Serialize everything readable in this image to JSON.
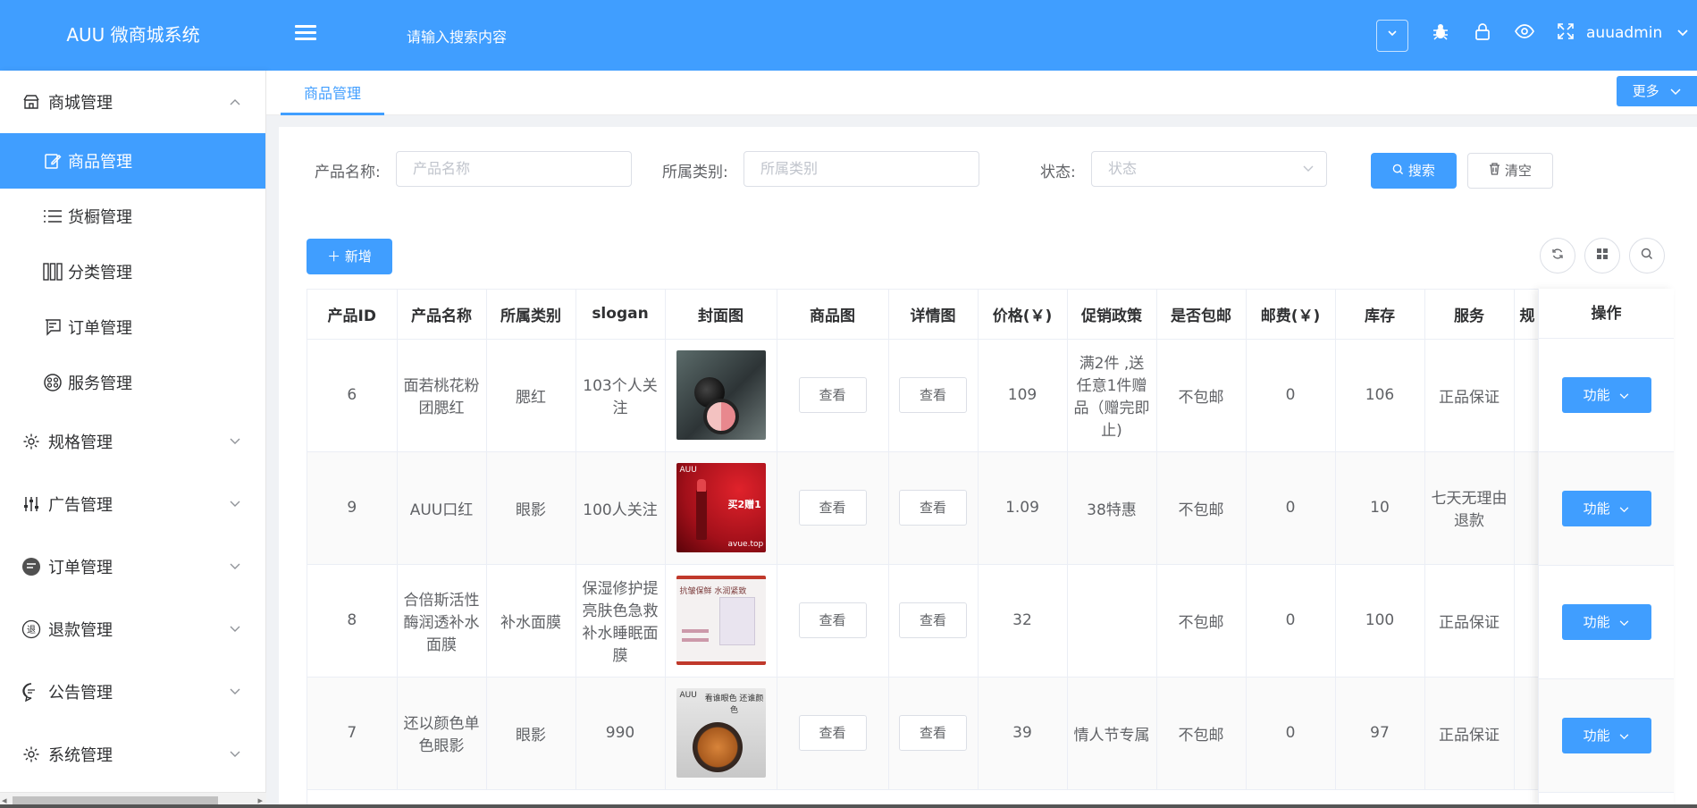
{
  "app": {
    "title": "AUU 微商城系统",
    "search_placeholder": "请输入搜索内容",
    "username": "auuadmin"
  },
  "icons": {
    "menu": "hamburger-icon",
    "dropdown": "chevron-down-icon",
    "bug": "bug-icon",
    "lock": "lock-icon",
    "eye": "eye-icon",
    "fullscreen": "fullscreen-icon"
  },
  "sidebar": {
    "groups": [
      {
        "label": "商城管理",
        "icon": "shop-icon",
        "expanded": true,
        "items": [
          {
            "label": "商品管理",
            "icon": "edit-icon",
            "active": true
          },
          {
            "label": "货橱管理",
            "icon": "list-icon"
          },
          {
            "label": "分类管理",
            "icon": "columns-icon"
          },
          {
            "label": "订单管理",
            "icon": "order-icon"
          },
          {
            "label": "服务管理",
            "icon": "service-icon"
          }
        ]
      },
      {
        "label": "规格管理",
        "icon": "gear-icon"
      },
      {
        "label": "广告管理",
        "icon": "sliders-icon"
      },
      {
        "label": "订单管理",
        "icon": "chat-icon"
      },
      {
        "label": "退款管理",
        "icon": "refund-icon"
      },
      {
        "label": "公告管理",
        "icon": "message-icon"
      },
      {
        "label": "系统管理",
        "icon": "gear-icon"
      }
    ]
  },
  "tabs": {
    "active": "商品管理",
    "more": "更多"
  },
  "search_form": {
    "name_label": "产品名称:",
    "name_placeholder": "产品名称",
    "category_label": "所属类别:",
    "category_placeholder": "所属类别",
    "status_label": "状态:",
    "status_placeholder": "状态",
    "search_button": "搜索",
    "clear_button": "清空"
  },
  "toolbar": {
    "add_button": "新增"
  },
  "table": {
    "columns": [
      "产品ID",
      "产品名称",
      "所属类别",
      "slogan",
      "封面图",
      "商品图",
      "详情图",
      "价格(￥)",
      "促销政策",
      "是否包邮",
      "邮费(￥)",
      "库存",
      "服务",
      "规"
    ],
    "action_column": "操作",
    "view_label": "查看",
    "action_label": "功能",
    "rows": [
      {
        "id": "6",
        "name": "面若桃花粉团腮红",
        "category": "腮红",
        "slogan": "103个人关注",
        "price": "109",
        "promo": "满2件 ,送任意1件赠品（赠完即止)",
        "shipping": "不包邮",
        "postage": "0",
        "stock": "106",
        "service": "正品保证"
      },
      {
        "id": "9",
        "name": "AUU口红",
        "category": "眼影",
        "slogan": "100人关注",
        "price": "1.09",
        "promo": "38特惠",
        "shipping": "不包邮",
        "postage": "0",
        "stock": "10",
        "service": "七天无理由退款"
      },
      {
        "id": "8",
        "name": "合倍斯活性酶润透补水面膜",
        "category": "补水面膜",
        "slogan": "保湿修护提亮肤色急救补水睡眠面膜",
        "price": "32",
        "promo": "",
        "shipping": "不包邮",
        "postage": "0",
        "stock": "100",
        "service": "正品保证"
      },
      {
        "id": "7",
        "name": "还以颜色单色眼影",
        "category": "眼影",
        "slogan": "990",
        "price": "39",
        "promo": "情人节专属",
        "shipping": "不包邮",
        "postage": "0",
        "stock": "97",
        "service": "正品保证"
      }
    ]
  },
  "covers": {
    "c2_brand": "AUU",
    "c2_site": "avue.top",
    "c2_promo": "买2赠1",
    "c3_text": "抗皱保鲜 水润紧致",
    "c4_brand": "AUU",
    "c4_text": "看谁眼色 还谁颜色"
  }
}
